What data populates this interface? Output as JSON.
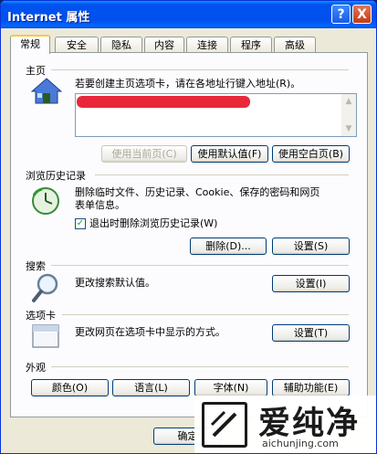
{
  "window": {
    "title": "Internet 属性",
    "help_label": "?",
    "close_label": "X"
  },
  "tabs": [
    {
      "label": "常规",
      "active": true
    },
    {
      "label": "安全"
    },
    {
      "label": "隐私"
    },
    {
      "label": "内容"
    },
    {
      "label": "连接"
    },
    {
      "label": "程序"
    },
    {
      "label": "高级"
    }
  ],
  "home": {
    "section_label": "主页",
    "description": "若要创建主页选项卡，请在各地址行键入地址(R)。",
    "address_value": "",
    "use_current_label": "使用当前页(C)",
    "use_default_label": "使用默认值(F)",
    "use_blank_label": "使用空白页(B)"
  },
  "history": {
    "section_label": "浏览历史记录",
    "description_line1": "删除临时文件、历史记录、Cookie、保存的密码和网页",
    "description_line2": "表单信息。",
    "checkbox_label": "退出时删除浏览历史记录(W)",
    "checkbox_checked": true,
    "delete_label": "删除(D)...",
    "settings_label": "设置(S)"
  },
  "search": {
    "section_label": "搜索",
    "description": "更改搜索默认值。",
    "settings_label": "设置(I)"
  },
  "tabs_section": {
    "section_label": "选项卡",
    "description": "更改网页在选项卡中显示的方式。",
    "settings_label": "设置(T)"
  },
  "appearance": {
    "section_label": "外观",
    "colors_label": "颜色(O)",
    "languages_label": "语言(L)",
    "fonts_label": "字体(N)",
    "accessibility_label": "辅助功能(E)"
  },
  "footer": {
    "ok_label": "确定"
  },
  "watermark": {
    "brand": "爱纯净",
    "url": "aichunjing.com"
  },
  "colors": {
    "titlebar": "#0054e3",
    "red_annotation": "#e8283a"
  }
}
